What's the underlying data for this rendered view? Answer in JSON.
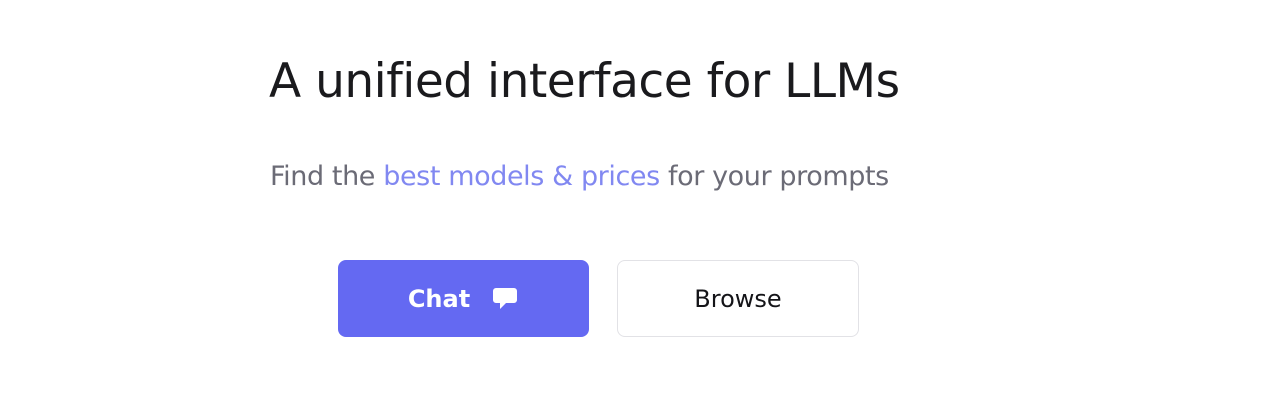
{
  "hero": {
    "headline": "A unified interface for LLMs",
    "subline_prefix": "Find the ",
    "subline_highlight": "best models & prices",
    "subline_suffix": " for your prompts"
  },
  "actions": {
    "chat_label": "Chat",
    "chat_icon": "chat-bubble-icon",
    "browse_label": "Browse"
  },
  "colors": {
    "accent": "#6469f2",
    "highlight_text": "#8188f1",
    "headline_text": "#1a1a1d",
    "muted_text": "#6b6b76"
  }
}
